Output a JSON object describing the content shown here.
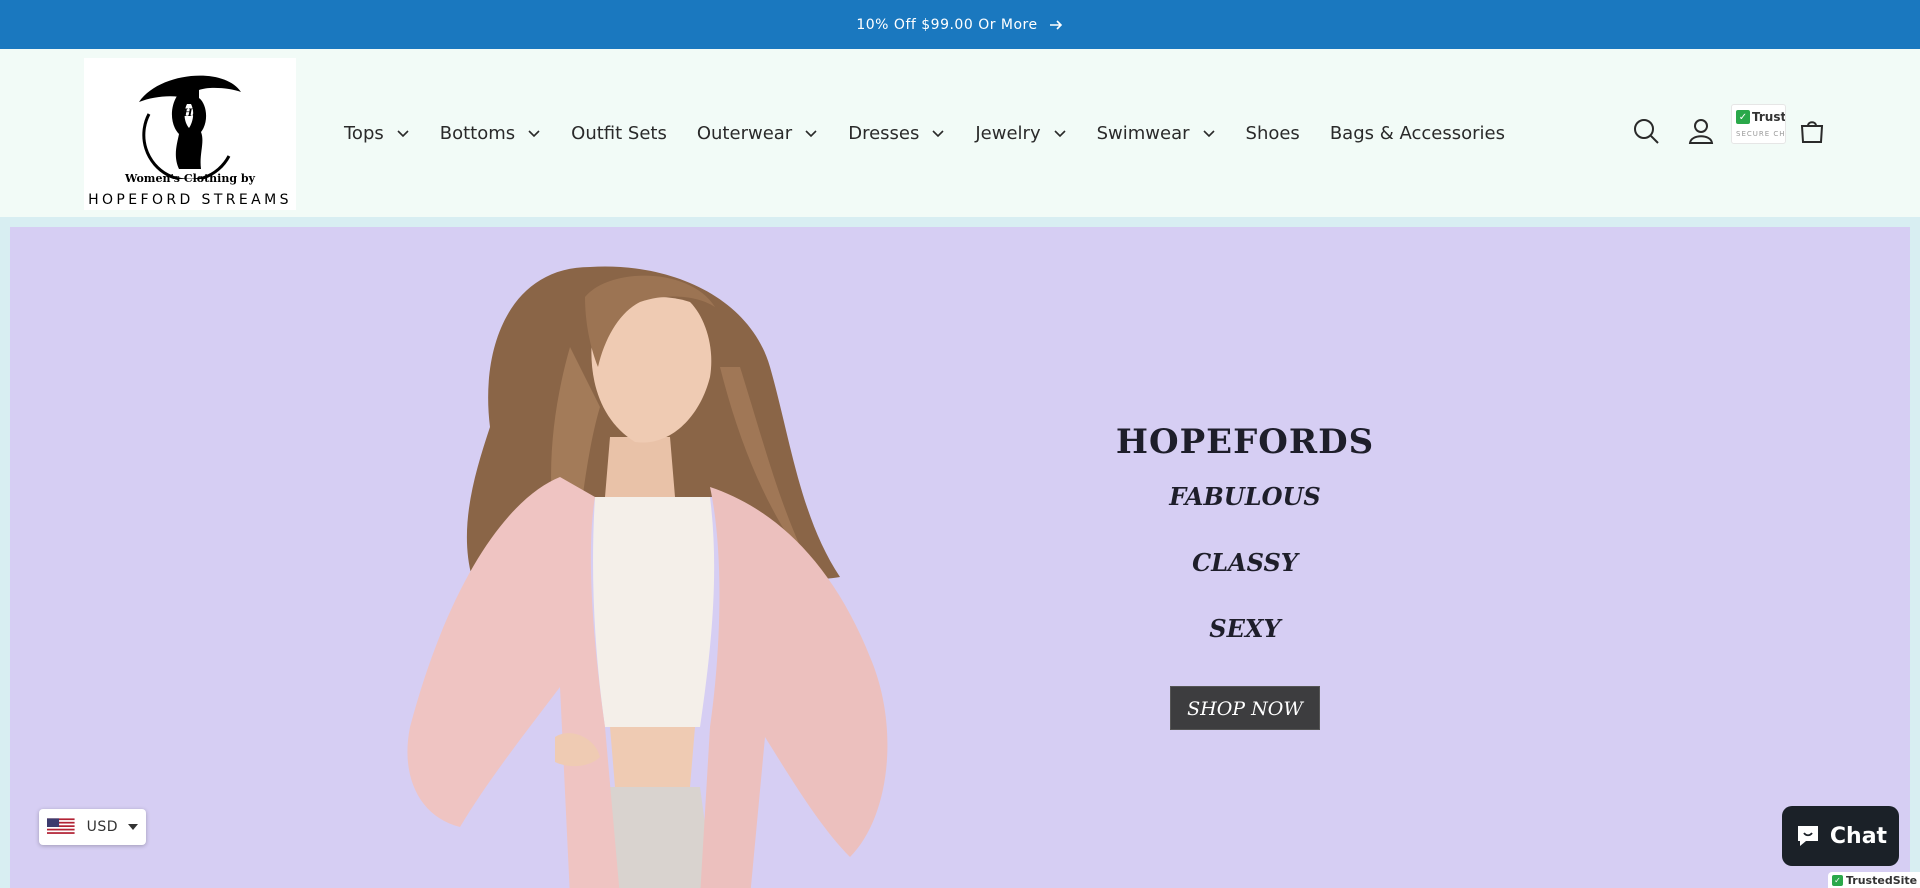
{
  "announcement": {
    "text": "10% Off $99.00 Or More"
  },
  "logo": {
    "tagline": "Women's Clothing by",
    "brand": "HOPEFORD STREAMS",
    "monogram": "HS"
  },
  "nav": {
    "items": [
      {
        "label": "Tops",
        "dropdown": true
      },
      {
        "label": "Bottoms",
        "dropdown": true
      },
      {
        "label": "Outfit Sets",
        "dropdown": false
      },
      {
        "label": "Outerwear",
        "dropdown": true
      },
      {
        "label": "Dresses",
        "dropdown": true
      },
      {
        "label": "Jewelry",
        "dropdown": true
      },
      {
        "label": "Swimwear",
        "dropdown": true
      },
      {
        "label": "Shoes",
        "dropdown": false
      },
      {
        "label": "Bags & Accessories",
        "dropdown": false
      }
    ]
  },
  "header_icons": {
    "search": "search-icon",
    "account": "account-icon",
    "cart": "cart-icon"
  },
  "trust_badge": {
    "title": "Truste",
    "subtitle": "SECURE CH"
  },
  "hero": {
    "title": "HOPEFORDS",
    "lines": [
      "FABULOUS",
      "CLASSY",
      "SEXY"
    ],
    "cta": "SHOP NOW"
  },
  "currency": {
    "code": "USD"
  },
  "chat": {
    "label": "Chat"
  },
  "trusted_site": {
    "label": "TrustedSite"
  },
  "colors": {
    "announcement_bg": "#1a78bf",
    "header_bg": "#f2fbf7",
    "hero_bg": "#d6cef3",
    "cta_bg": "#3d3d3f",
    "chat_bg": "#1b2128"
  }
}
